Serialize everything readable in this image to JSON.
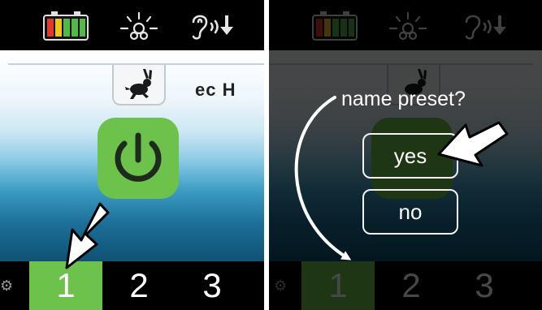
{
  "left_screen": {
    "status_icons": [
      "battery-icon",
      "brightness-icon",
      "hearing-volume-icon"
    ],
    "mode_tab_icon": "rabbit-icon",
    "mode_label": "ec H",
    "power_button_icon": "power-icon",
    "presets": [
      "1",
      "2",
      "3"
    ],
    "active_preset": "1"
  },
  "right_screen": {
    "dialog": {
      "title": "name preset?",
      "yes_label": "yes",
      "no_label": "no"
    },
    "presets": [
      "1",
      "2",
      "3"
    ]
  },
  "colors": {
    "accent_green": "#6cc24a",
    "battery_red": "#e23a2a",
    "battery_yellow": "#f0c419",
    "battery_green": "#54b848"
  }
}
